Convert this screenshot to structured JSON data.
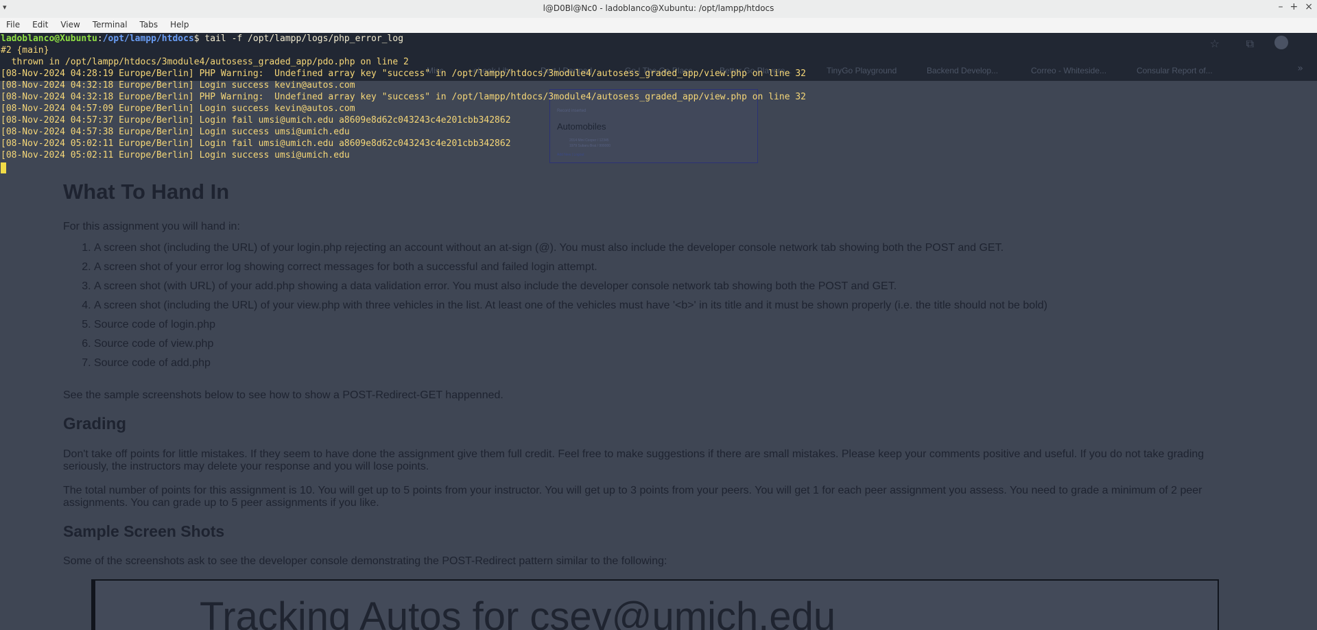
{
  "window": {
    "title": "l@D0Bl@Nc0 - ladoblanco@Xubuntu: /opt/lampp/htdocs",
    "menu_icon": "triangle-down-icon",
    "controls": [
      "minimize-icon",
      "maximize-icon",
      "close-icon"
    ]
  },
  "menubar": [
    "File",
    "Edit",
    "View",
    "Terminal",
    "Tabs",
    "Help"
  ],
  "terminal": {
    "prompt_user": "ladoblanco@Xubuntu",
    "prompt_sep": ":",
    "prompt_path": "/opt/lampp/htdocs",
    "prompt_end": "$",
    "command": " tail -f /opt/lampp/logs/php_error_log",
    "lines": [
      "#2 {main}",
      "  thrown in /opt/lampp/htdocs/3module4/autosess_graded_app/pdo.php on line 2",
      "[08-Nov-2024 04:28:19 Europe/Berlin] PHP Warning:  Undefined array key \"success\" in /opt/lampp/htdocs/3module4/autosess_graded_app/view.php on line 32",
      "[08-Nov-2024 04:32:18 Europe/Berlin] Login success kevin@autos.com",
      "[08-Nov-2024 04:32:18 Europe/Berlin] PHP Warning:  Undefined array key \"success\" in /opt/lampp/htdocs/3module4/autosess_graded_app/view.php on line 32",
      "[08-Nov-2024 04:57:09 Europe/Berlin] Login success kevin@autos.com",
      "[08-Nov-2024 04:57:37 Europe/Berlin] Login fail umsi@umich.edu a8609e8d62c043243c4e201cbb342862",
      "[08-Nov-2024 04:57:38 Europe/Berlin] Login success umsi@umich.edu",
      "[08-Nov-2024 05:02:11 Europe/Berlin] Login fail umsi@umich.edu a8609e8d62c043243c4e201cbb342862",
      "[08-Nov-2024 05:02:11 Europe/Berlin] Login success umsi@umich.edu"
    ]
  },
  "background_page": {
    "bookmarks": [
      "Misc",
      "ebook Libs",
      "Dart | Dartpad",
      "Go | The Go Place",
      "Better Go Playgro...",
      "TinyGo Playground",
      "Backend Develop...",
      "Correo - Whiteside...",
      "Consular Report of..."
    ],
    "thumbnail": {
      "small_text": "Record inserted",
      "heading": "Automobiles",
      "items": [
        "2014 Mini Cooper / 12345",
        "1979 Subaru Brat / 999000"
      ],
      "links": "Add New | Logout"
    },
    "heading_hand_in": "What To Hand In",
    "intro": "For this assignment you will hand in:",
    "hand_in_items": [
      "A screen shot (including the URL) of your login.php rejecting an account without an at-sign (@). You must also include the developer console network tab showing both the POST and GET.",
      "A screen shot of your error log showing correct messages for both a successful and failed login attempt.",
      "A screen shot (with URL) of your add.php showing a data validation error. You must also include the developer console network tab showing both the POST and GET.",
      "A screen shot (including the URL) of your view.php with three vehicles in the list. At least one of the vehicles must have '<b>' in its title and it must be shown properly (i.e. the title should not be bold)",
      "Source code of login.php",
      "Source code of view.php",
      "Source code of add.php"
    ],
    "sample_note": "See the sample screenshots below to see how to show a POST-Redirect-GET happenned.",
    "heading_grading": "Grading",
    "grading_p1": "Don't take off points for little mistakes. If they seem to have done the assignment give them full credit. Feel free to make suggestions if there are small mistakes. Please keep your comments positive and useful. If you do not take grading seriously, the instructors may delete your response and you will lose points.",
    "grading_p2": "The total number of points for this assignment is 10. You will get up to 5 points from your instructor. You will get up to 3 points from your peers. You will get 1 for each peer assignment you assess. You need to grade a minimum of 2 peer assignments. You can grade up to 5 peer assignments if you like.",
    "heading_shots": "Sample Screen Shots",
    "shots_intro": "Some of the screenshots ask to see the developer console demonstrating the POST-Redirect pattern similar to the following:",
    "big_screenshot_title": "Tracking Autos for csev@umich.edu"
  }
}
